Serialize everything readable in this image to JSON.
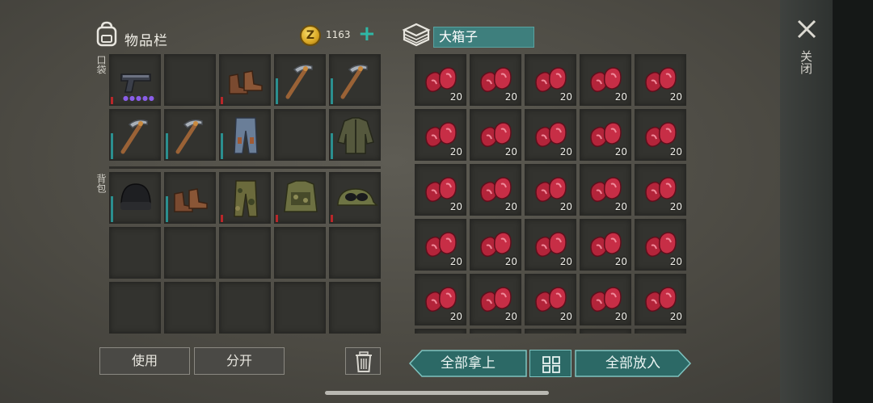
{
  "inventory": {
    "title": "物品栏",
    "coins": "1163",
    "coin_symbol": "Z",
    "plus_label": "+",
    "pocket_label": "口袋",
    "backpack_label": "背包",
    "use_label": "使用",
    "split_label": "分开",
    "pocket_slots": [
      {
        "item": "pistol-icon",
        "durability": "red",
        "ammo_dots": "●●●●●"
      },
      {
        "item": "empty-slot",
        "durability": "",
        "ammo_dots": ""
      },
      {
        "item": "boots-icon",
        "durability": "red",
        "ammo_dots": ""
      },
      {
        "item": "pickaxe-icon",
        "durability": "teal",
        "ammo_dots": ""
      },
      {
        "item": "pickaxe-icon",
        "durability": "teal",
        "ammo_dots": ""
      },
      {
        "item": "pickaxe-icon",
        "durability": "teal",
        "ammo_dots": ""
      },
      {
        "item": "pickaxe-icon",
        "durability": "teal",
        "ammo_dots": ""
      },
      {
        "item": "pants-icon",
        "durability": "teal",
        "ammo_dots": ""
      },
      {
        "item": "empty-slot",
        "durability": "",
        "ammo_dots": ""
      },
      {
        "item": "jacket-icon",
        "durability": "teal",
        "ammo_dots": ""
      }
    ],
    "backpack_slots": [
      {
        "item": "beanie-icon",
        "durability": "teal"
      },
      {
        "item": "boots-icon",
        "durability": "teal"
      },
      {
        "item": "camo-pants-icon",
        "durability": "red"
      },
      {
        "item": "camo-vest-icon",
        "durability": "red"
      },
      {
        "item": "goggles-cap-icon",
        "durability": "red"
      },
      {
        "item": "empty-slot",
        "durability": ""
      },
      {
        "item": "empty-slot",
        "durability": ""
      },
      {
        "item": "empty-slot",
        "durability": ""
      },
      {
        "item": "empty-slot",
        "durability": ""
      },
      {
        "item": "empty-slot",
        "durability": ""
      },
      {
        "item": "empty-slot",
        "durability": ""
      },
      {
        "item": "empty-slot",
        "durability": ""
      },
      {
        "item": "empty-slot",
        "durability": ""
      },
      {
        "item": "empty-slot",
        "durability": ""
      },
      {
        "item": "empty-slot",
        "durability": ""
      }
    ]
  },
  "container": {
    "name": "大箱子",
    "icon": "crate-icon",
    "item": "raw-meat-icon",
    "stack_qty": "20",
    "stack_count": 30,
    "take_all_label": "全部拿上",
    "put_all_label": "全部放入",
    "sort_icon": "grid-sort-icon"
  },
  "close": {
    "label": "关闭"
  },
  "colors": {
    "accent_teal": "#2fb8a6",
    "button_teal": "#2c6966",
    "durability_red": "#b8272a",
    "durability_teal": "#2b8f8f"
  }
}
